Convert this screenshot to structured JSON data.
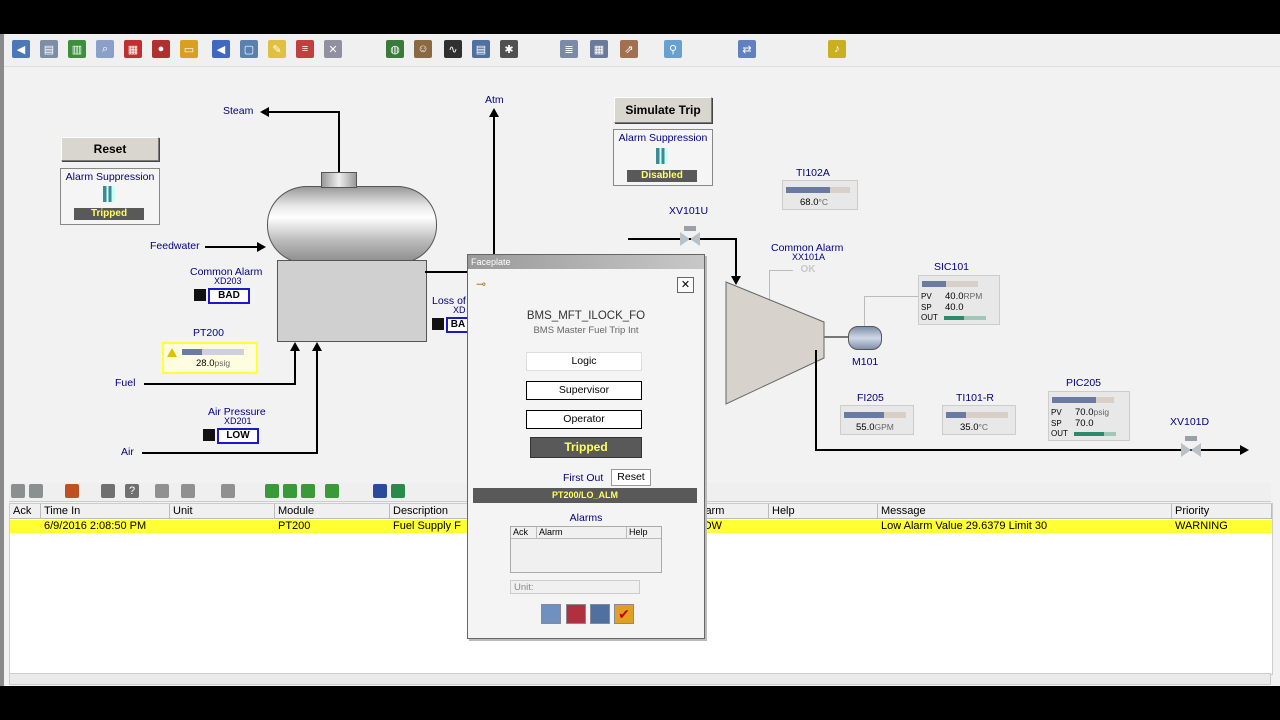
{
  "colors": {
    "accent_yellow": "#ffff33",
    "status_blue": "#1a1acc",
    "tripped_bg": "#595959",
    "tripped_text": "#ffff66"
  },
  "toolbar": {
    "icons": [
      "back-icon",
      "print-icon",
      "trend-icon",
      "search-icon",
      "grid-icon",
      "users-icon",
      "folder-icon",
      "left-arrow-icon",
      "display-icon",
      "note-icon",
      "list-icon",
      "delete-icon",
      "globe-icon",
      "group-icon",
      "chart-icon",
      "edit-icon",
      "tools-icon",
      "report-icon",
      "table-icon",
      "export-icon",
      "filter-icon",
      "layout-icon",
      "bell-icon"
    ]
  },
  "diagram": {
    "reset_left": "Reset",
    "simulate_trip": "Simulate Trip",
    "suppression_left": {
      "title": "Alarm Suppression",
      "status": "Tripped"
    },
    "suppression_right": {
      "title": "Alarm Suppression",
      "status": "Disabled"
    },
    "steam": "Steam",
    "atm": "Atm",
    "feedwater": "Feedwater",
    "fuel": "Fuel",
    "air": "Air",
    "common_alarm_left": {
      "title": "Common Alarm",
      "tag": "XD203",
      "status": "BAD"
    },
    "loss_of": {
      "title": "Loss of",
      "tag": "XD",
      "status": "BA"
    },
    "pt200": {
      "tag": "PT200",
      "value": "28.0",
      "unit": "psig"
    },
    "air_pressure": {
      "title": "Air Pressure",
      "tag": "XD201",
      "status": "LOW"
    },
    "xv101u": "XV101U",
    "ti102a": {
      "tag": "TI102A",
      "value": "68.0",
      "unit": "°C"
    },
    "common_alarm_right": {
      "title": "Common Alarm",
      "tag": "XX101A",
      "status": "OK"
    },
    "sic101": {
      "tag": "SIC101",
      "pv_label": "PV",
      "pv": "40.0",
      "pv_unit": "RPM",
      "sp_label": "SP",
      "sp": "40.0",
      "out_label": "OUT"
    },
    "m101": "M101",
    "fi205": {
      "tag": "FI205",
      "value": "55.0",
      "unit": "GPM"
    },
    "ti101r": {
      "tag": "TI101-R",
      "value": "35.0",
      "unit": "°C"
    },
    "pic205": {
      "tag": "PIC205",
      "pv_label": "PV",
      "pv": "70.0",
      "pv_unit": "psig",
      "sp_label": "SP",
      "sp": "70.0",
      "out_label": "OUT"
    },
    "xv101d": "XV101D"
  },
  "faceplate": {
    "title": "Faceplate",
    "name": "BMS_MFT_ILOCK_FO",
    "description": "BMS Master Fuel Trip Int",
    "logic": "Logic",
    "supervisor": "Supervisor",
    "operator": "Operator",
    "state": "Tripped",
    "first_out_label": "First Out",
    "reset": "Reset",
    "first_out_value": "PT200/LO_ALM",
    "alarms_label": "Alarms",
    "alarm_cols": [
      "Ack",
      "Alarm",
      "Help"
    ],
    "unit_placeholder": "Unit:"
  },
  "alarm_grid": {
    "columns": [
      "Ack",
      "Time In",
      "Unit",
      "Module",
      "Description",
      "larm",
      "Help",
      "Message",
      "Priority"
    ],
    "rows": [
      {
        "ack": "",
        "time": "6/9/2016 2:08:50 PM",
        "unit": "",
        "module": "PT200",
        "description": "Fuel Supply F",
        "alarm": "OW",
        "help": "",
        "message": "Low Alarm Value 29.6379 Limit 30",
        "priority": "WARNING"
      }
    ]
  }
}
